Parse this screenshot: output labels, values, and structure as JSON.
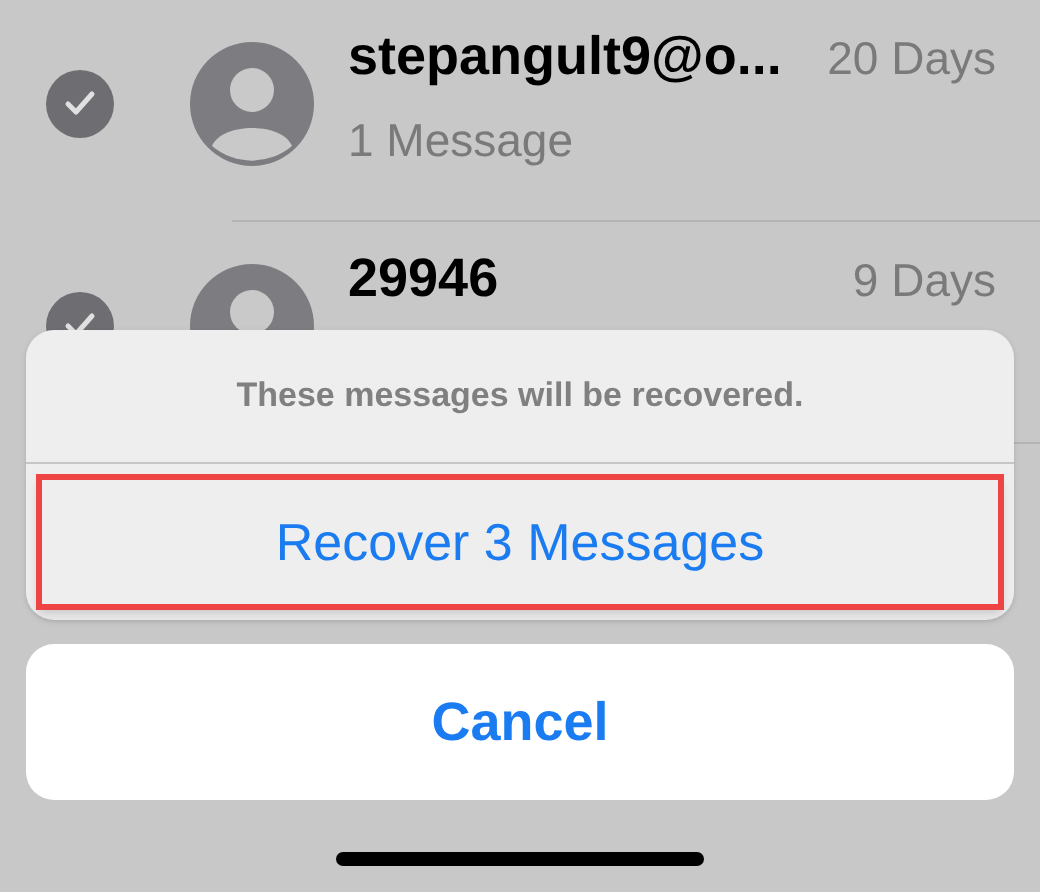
{
  "conversations": [
    {
      "name": "stepangult9@o...",
      "date": "20 Days",
      "subtitle": "1 Message",
      "checked": true
    },
    {
      "name": "29946",
      "date": "9 Days",
      "checked": true
    }
  ],
  "action_sheet": {
    "message": "These messages will be recovered.",
    "actions": [
      {
        "label": "Recover 3 Messages",
        "highlighted": true
      }
    ],
    "cancel": "Cancel"
  }
}
